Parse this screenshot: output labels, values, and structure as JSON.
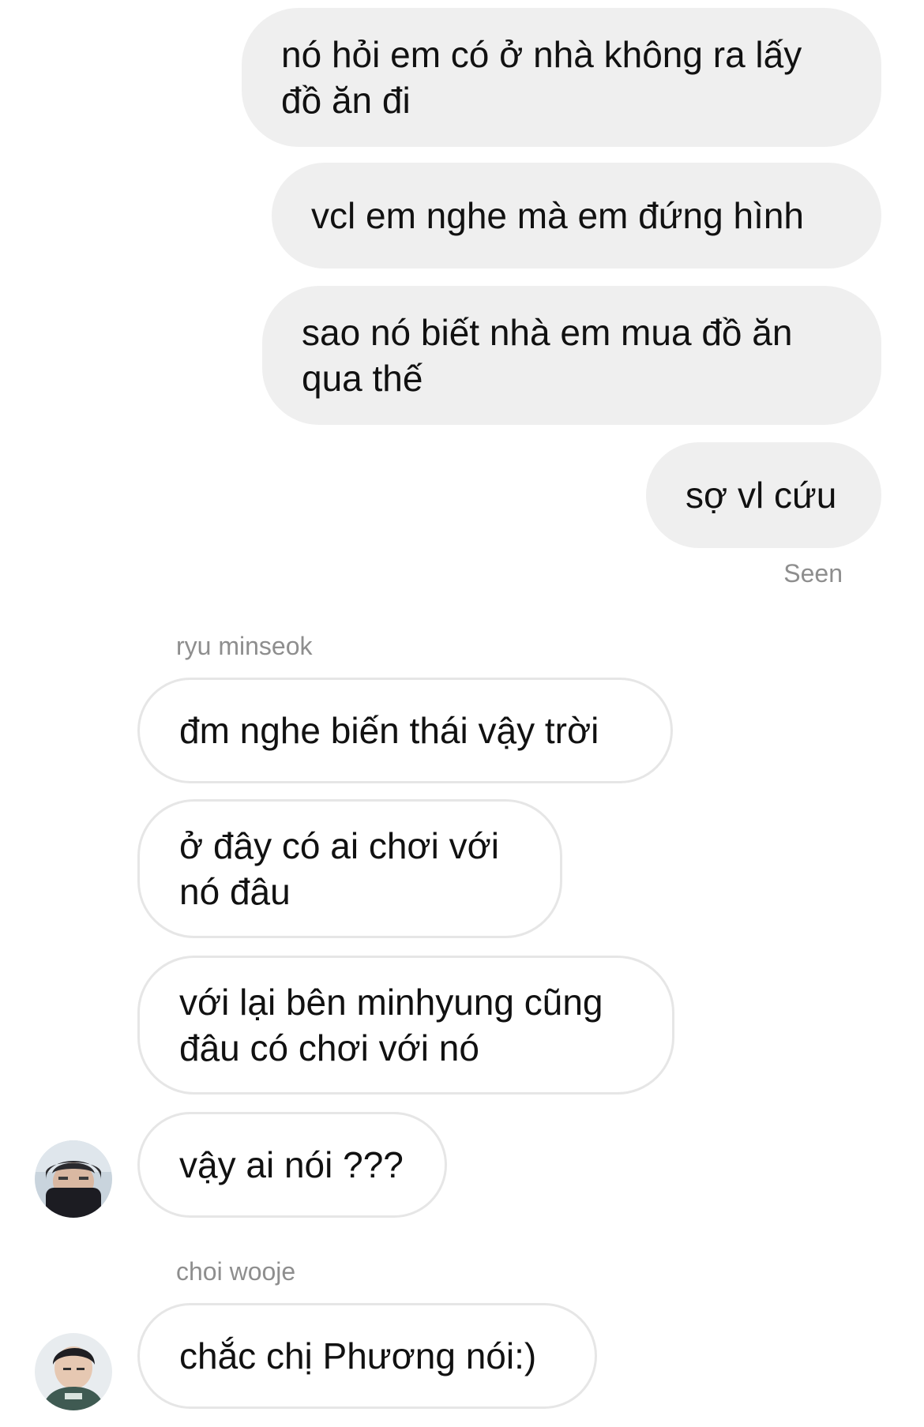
{
  "thread": {
    "outgoing": [
      {
        "text": "nó hỏi em có ở nhà không ra lấy\nđồ ăn đi"
      },
      {
        "text": "vcl em nghe mà em đứng hình"
      },
      {
        "text": "sao nó biết nhà em mua đồ ăn\nqua thế"
      },
      {
        "text": "sợ vl cứu"
      }
    ],
    "seen_label": "Seen",
    "groups": [
      {
        "sender": "ryu minseok",
        "messages": [
          {
            "text": "đm nghe biến thái vậy trời"
          },
          {
            "text": "ở đây có ai chơi với\nnó đâu"
          },
          {
            "text": "với lại bên minhyung cũng\nđâu có chơi với nó"
          },
          {
            "text": "vậy ai nói ???"
          }
        ],
        "avatar_icon": "avatar-photo"
      },
      {
        "sender": "choi wooje",
        "messages": [
          {
            "text": "chắc chị Phương nói:)"
          }
        ],
        "avatar_icon": "avatar-photo"
      }
    ]
  },
  "colors": {
    "outgoing_bubble": "#efefef",
    "incoming_border": "#e6e6e6",
    "meta_text": "#8e8e8e"
  }
}
